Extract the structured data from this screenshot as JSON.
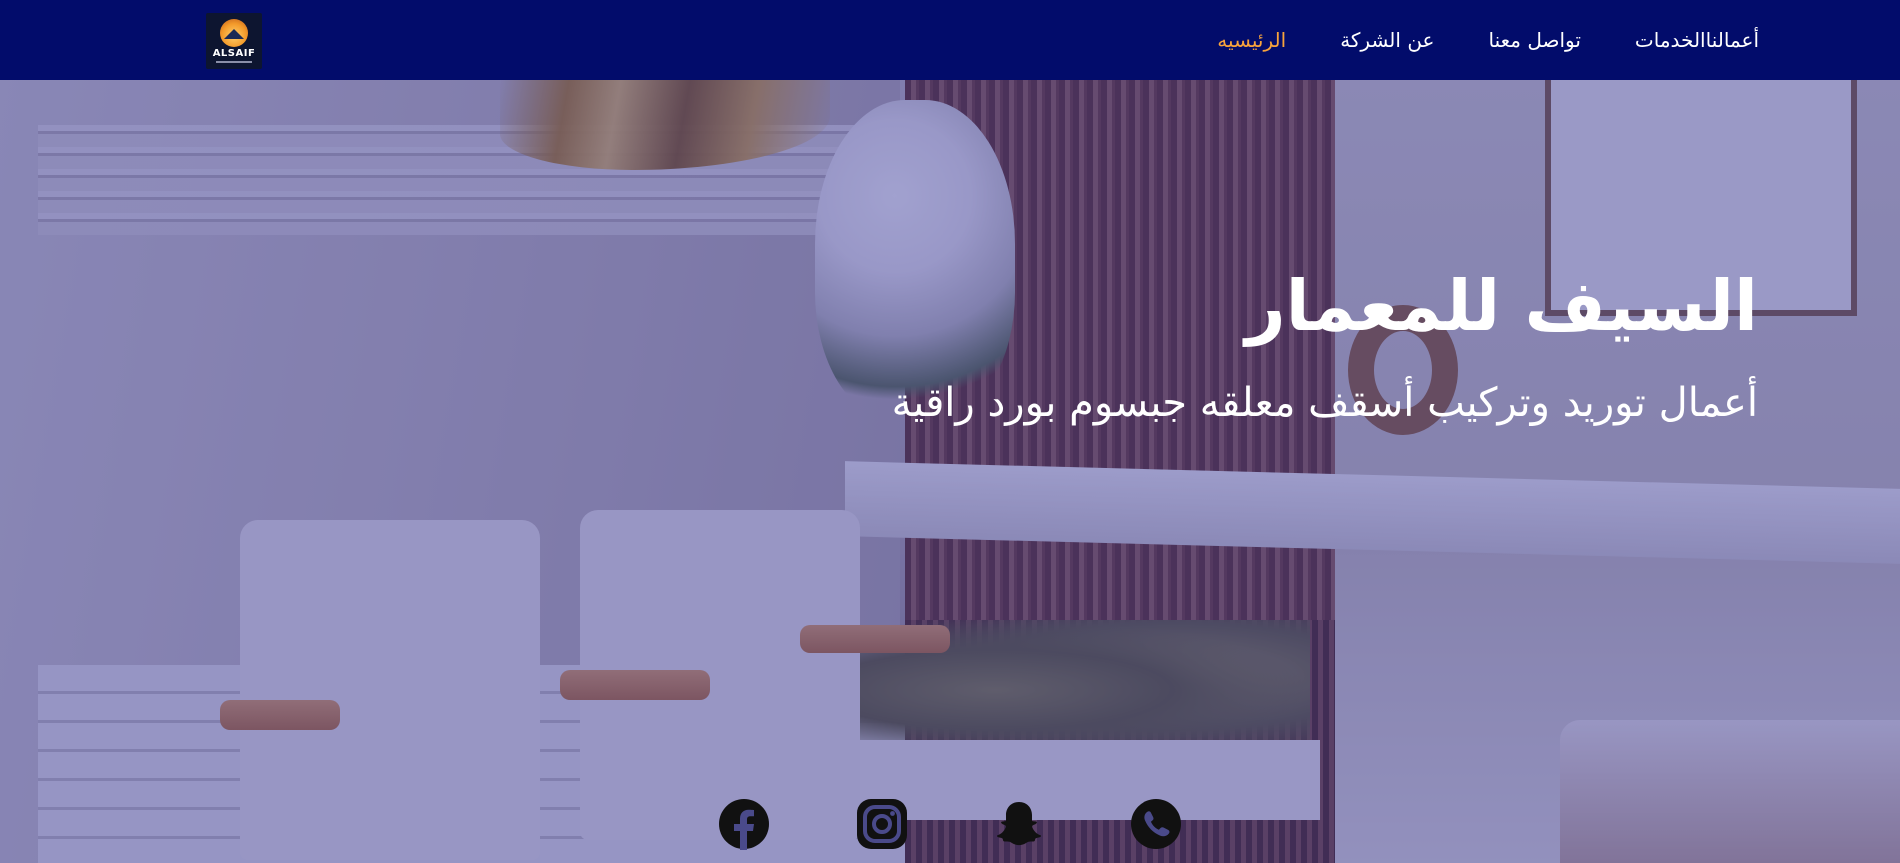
{
  "nav": {
    "logo_text": "ALSAIF",
    "links": [
      {
        "label": "الرئيسيه",
        "active": true
      },
      {
        "label": "عن الشركة",
        "active": false
      },
      {
        "label": "تواصل معنا",
        "active": false
      },
      {
        "label": "الخدمات",
        "active": false
      },
      {
        "label": "أعمالنا",
        "active": false
      }
    ]
  },
  "hero": {
    "title": "السيف للمعمار",
    "subtitle": "أعمال توريد وتركيب أسقف معلقه جبسوم بورد راقية"
  },
  "socials": [
    {
      "name": "facebook",
      "icon": "facebook-icon"
    },
    {
      "name": "instagram",
      "icon": "instagram-icon"
    },
    {
      "name": "snapchat",
      "icon": "snapchat-icon"
    },
    {
      "name": "whatsapp",
      "icon": "whatsapp-icon"
    }
  ],
  "colors": {
    "navbar_bg": "#020c6b",
    "active_link": "#f7a33c",
    "text": "#ffffff",
    "overlay": "rgba(30,30,140,0.42)"
  }
}
